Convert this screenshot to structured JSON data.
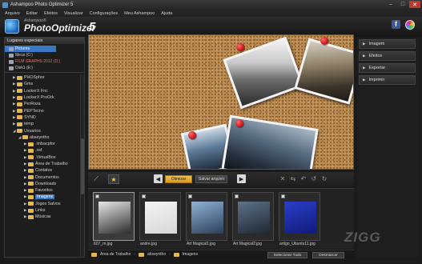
{
  "window": {
    "title": "Ashampoo Photo Optimizer 5"
  },
  "menu": [
    "Arquivo",
    "Editar",
    "Efeitos",
    "Visualizar",
    "Configurações",
    "Meu Ashampoo",
    "Ajuda"
  ],
  "logo": {
    "brand": "Ashampoo®",
    "name": "PhotoOptimizer",
    "version": "5"
  },
  "left_panel": {
    "special_header": "Lugares especiais",
    "special_items": [
      {
        "label": "Pictures",
        "selected": true
      },
      {
        "label": "Meus (C:)"
      },
      {
        "label": "FILM GRAPHS 2012 (D:)",
        "red": true
      },
      {
        "label": "Disk1 (E:)"
      }
    ],
    "tree": [
      {
        "label": "PHOSphor",
        "indent": 1,
        "arrow": "▶"
      },
      {
        "label": "Gms",
        "indent": 1,
        "arrow": "▶"
      },
      {
        "label": "LockerX Fnc",
        "indent": 1,
        "arrow": "▶"
      },
      {
        "label": "LockerX ProOrk",
        "indent": 1,
        "arrow": "▶"
      },
      {
        "label": "PerRoza",
        "indent": 1,
        "arrow": "▶"
      },
      {
        "label": "PEPTecno",
        "indent": 1,
        "arrow": "▶"
      },
      {
        "label": "SYND",
        "indent": 1,
        "arrow": "▶"
      },
      {
        "label": "temp",
        "indent": 1,
        "arrow": "▶"
      },
      {
        "label": "Usuarios",
        "indent": 1,
        "arrow": "◢"
      },
      {
        "label": "abseyntho",
        "indent": 2,
        "arrow": "◢"
      },
      {
        "label": ".imbacpfor",
        "indent": 3,
        "arrow": "▶"
      },
      {
        "label": ".ssf",
        "indent": 3,
        "arrow": "▶"
      },
      {
        "label": ".VirtualBox",
        "indent": 3,
        "arrow": "▶"
      },
      {
        "label": "Área de Trabalho",
        "indent": 3,
        "arrow": "▶"
      },
      {
        "label": "Contatos",
        "indent": 3,
        "arrow": "▶"
      },
      {
        "label": "Documentos",
        "indent": 3,
        "arrow": "▶"
      },
      {
        "label": "Downloads",
        "indent": 3,
        "arrow": "▶"
      },
      {
        "label": "Favoritos",
        "indent": 3,
        "arrow": "▶"
      },
      {
        "label": "Imagens",
        "indent": 3,
        "arrow": "▶",
        "selected": true
      },
      {
        "label": "Jogos Salvos",
        "indent": 3,
        "arrow": "▶"
      },
      {
        "label": "Links",
        "indent": 3,
        "arrow": "▶"
      },
      {
        "label": "Músicas",
        "indent": 3,
        "arrow": "▶"
      }
    ]
  },
  "right_panel": {
    "sections": [
      "Imagem",
      "Efeitos",
      "Exportar",
      "Imprimir"
    ]
  },
  "toolbar": {
    "optimize_label": "Otimizar",
    "save_label": "Salvar arquivo"
  },
  "thumbnails": [
    {
      "label": "607_m.jpg",
      "selected": true,
      "colors": [
        "#e8e8e8",
        "#2b2b2b"
      ]
    },
    {
      "label": "andre.jpg",
      "selected": false,
      "colors": [
        "#f4f4f4",
        "#d7d7d7"
      ]
    },
    {
      "label": "Art Magical1.jpg",
      "selected": false,
      "colors": [
        "#8fb2d6",
        "#2c3e58"
      ]
    },
    {
      "label": "Art Magical2.jpg",
      "selected": false,
      "colors": [
        "#5e7288",
        "#1f2733"
      ]
    },
    {
      "label": "artigo_Ubuntu11.jpg",
      "selected": false,
      "colors": [
        "#2a3fc8",
        "#101a7a"
      ]
    }
  ],
  "status": {
    "crumbs": [
      "Área de Trabalho",
      "abseyntho",
      "Imagens"
    ],
    "select_all": "Selecionar Tudo",
    "deselect": "Desmarcar"
  },
  "watermark": "ZIGG",
  "accent": "#3a77c4",
  "optimize_color": "#e6ad2c"
}
